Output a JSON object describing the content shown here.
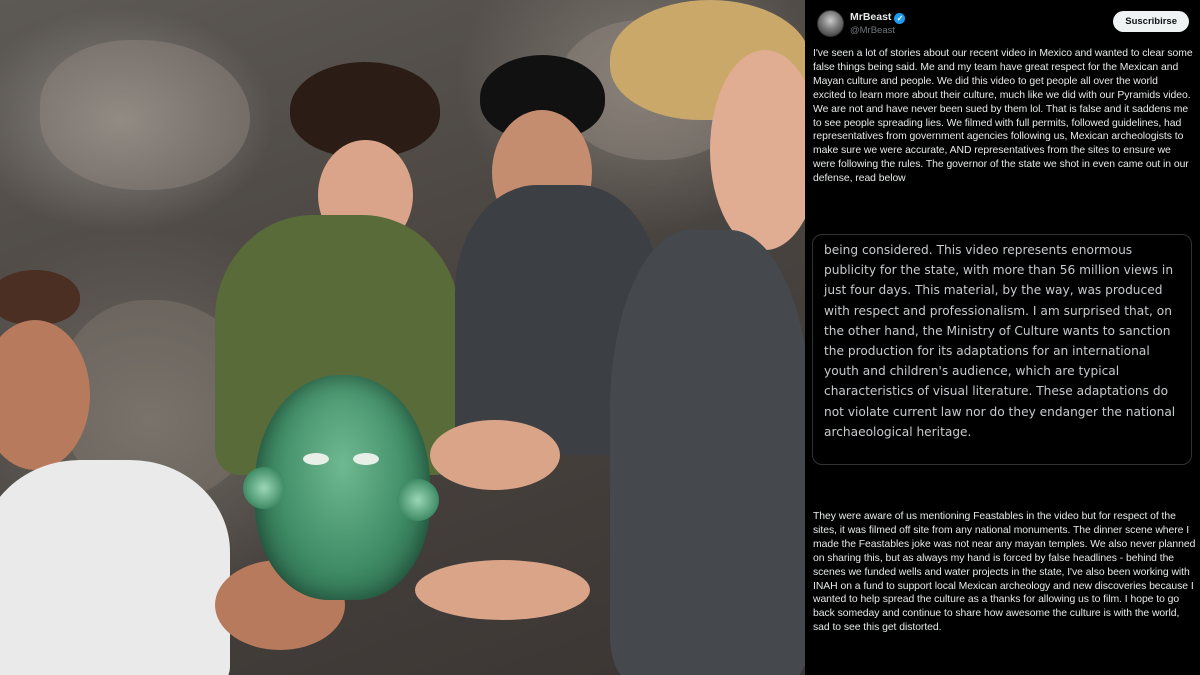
{
  "author": {
    "name": "MrBeast",
    "handle": "@MrBeast",
    "verified": true
  },
  "subscribe_label": "Suscribirse",
  "tweet_text_1": "I've seen a lot of stories about our recent video in Mexico and wanted to clear some false things being said. Me and my team have great respect for the Mexican and Mayan culture and people. We did this video to get people all over the world excited to learn more about their culture, much like we did with our Pyramids video. We are not and have never been sued by them lol. That is false and it saddens me to see people spreading lies. We filmed with full permits, followed guidelines, had representatives from government agencies following us, Mexican archeologists to make sure we were accurate, AND representatives from the sites to ensure we were following the rules. The governor of the state we shot in even came out in our defense, read below",
  "quoted_text": "being considered. This video represents enormous publicity for the state, with more than 56 million views in just four days. This material, by the way, was produced with respect and professionalism. I am surprised that, on the other hand, the Ministry of Culture wants to sanction the production for its adaptations for an international youth and children's audience, which are typical characteristics of visual literature. These adaptations do not violate current law nor do they endanger the national archaeological heritage.",
  "tweet_text_2": "They were aware of us mentioning Feastables in the video but for respect of the sites, it was filmed off site from any national monuments. The dinner scene where I made the Feastables joke was not near any mayan temples. We also never planned on sharing this, but as always my hand is forced by false headlines - behind the scenes we funded wells and water projects in the state,  I've also been working with INAH on a fund to support local Mexican archeology and new discoveries because I wanted to help spread the culture as a thanks for allowing us to film. I hope to go back someday and continue to share how awesome the culture is with the world, sad to see this get distorted.",
  "colors": {
    "background": "#000000",
    "text": "#e7e9ea",
    "secondary_text": "#71767b",
    "verified_badge": "#1d9bf0",
    "button_bg": "#eff3f4",
    "quote_border": "#2f3336"
  }
}
